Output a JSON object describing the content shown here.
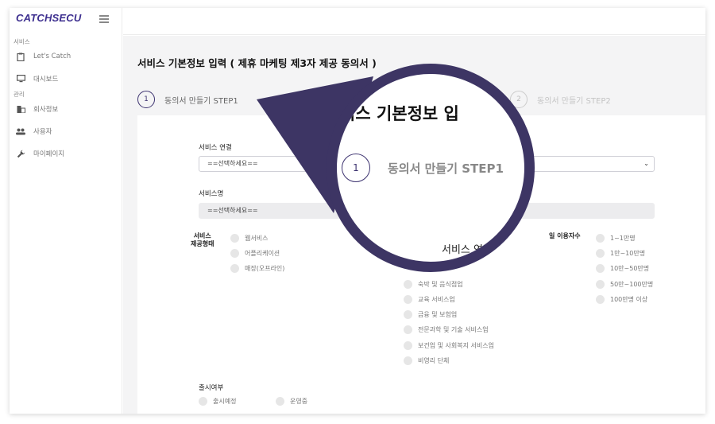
{
  "app": {
    "logo": "CATCHSECU"
  },
  "sidebar": {
    "section1": "서비스",
    "section2": "관리",
    "items": [
      {
        "label": "Let's Catch",
        "icon": "clipboard-icon"
      },
      {
        "label": "대시보드",
        "icon": "monitor-icon"
      },
      {
        "label": "회사정보",
        "icon": "building-icon"
      },
      {
        "label": "사용자",
        "icon": "users-icon"
      },
      {
        "label": "마이페이지",
        "icon": "wrench-icon"
      }
    ]
  },
  "page": {
    "title": "서비스 기본정보 입력 ( 제휴 마케팅 제3자 제공 동의서 )",
    "steps": [
      {
        "num": "1",
        "label": "동의서 만들기 STEP1",
        "active": true
      },
      {
        "num": "2",
        "label": "동의서 만들기 STEP2",
        "active": false
      }
    ]
  },
  "form": {
    "service_link_label": "서비스 연결",
    "service_link_value": "==선택하세요==",
    "service_name_label": "서비스명",
    "service_name_value": "==선택하세요==",
    "service_type_label_1": "서비스",
    "service_type_label_2": "제공형태",
    "service_type_options": [
      "웹서비스",
      "어플리케이션",
      "매장(오프라인)"
    ],
    "industry_options": [
      "숙박 및 음식점업",
      "교육 서비스업",
      "금융 및 보험업",
      "전문과학 및 기술 서비스업",
      "보건업 및 사회복지 서비스업",
      "비영리 단체"
    ],
    "daily_users_label": "일 이용자수",
    "daily_users_options": [
      "1~1만명",
      "1만~10만명",
      "10만~50만명",
      "50만~100만명",
      "100만명 이상"
    ],
    "release_label": "출시여부",
    "release_options": [
      "출시예정",
      "운영중"
    ]
  },
  "zoom": {
    "title_fragment": "비스 기본정보 입",
    "step_num": "1",
    "step_label": "동의서 만들기 STEP1",
    "field_fragment": "서비스 연결"
  },
  "colors": {
    "brand": "#3d2f8f",
    "lens_border": "#3d3564"
  }
}
